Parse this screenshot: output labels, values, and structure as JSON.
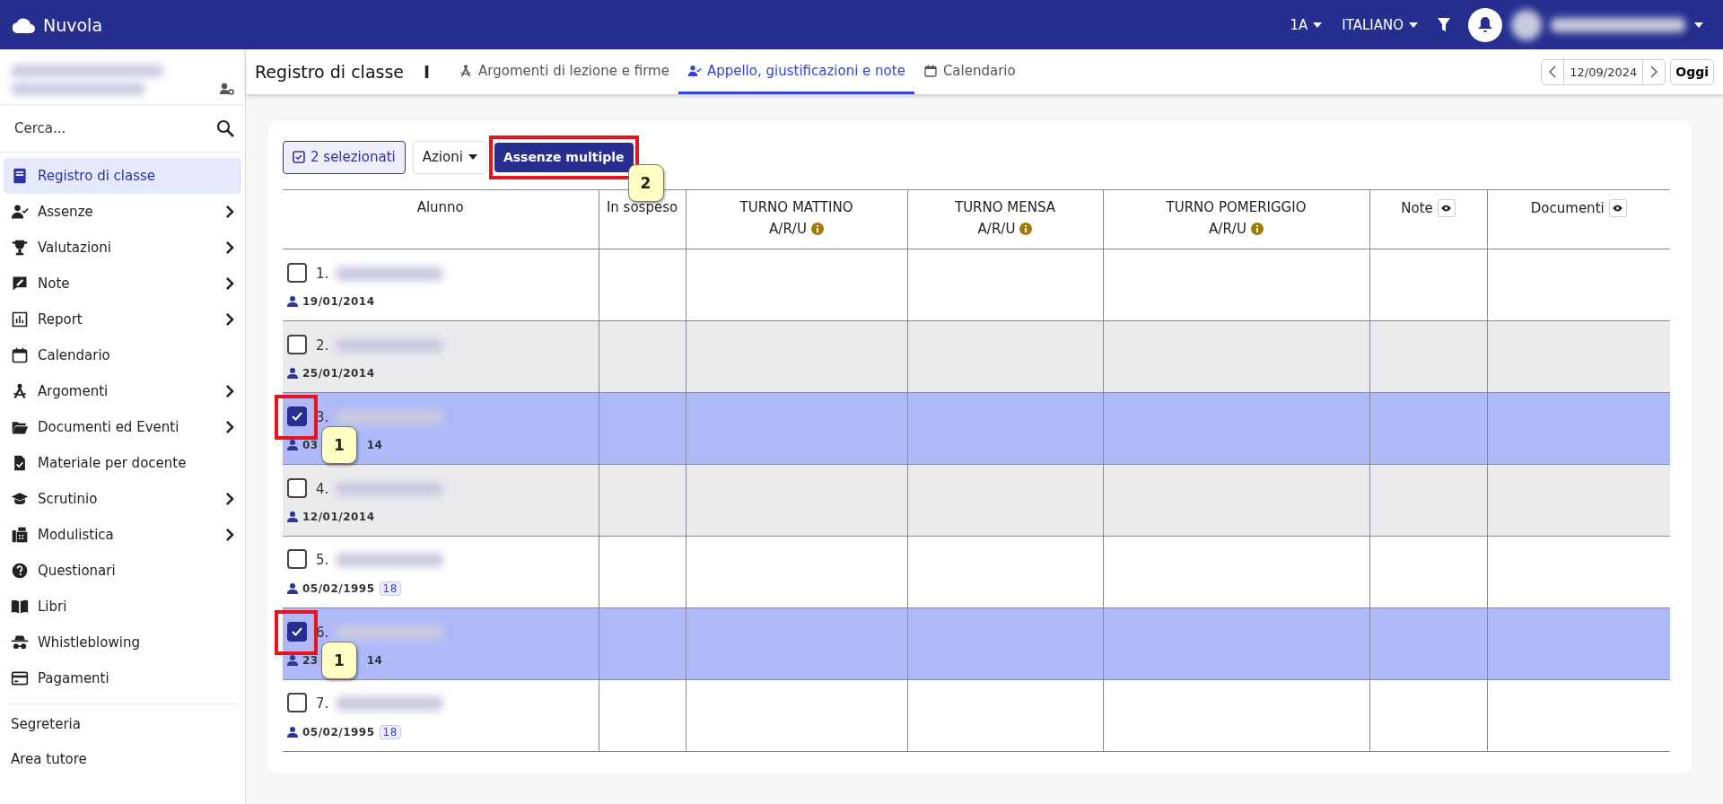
{
  "topbar": {
    "brand": "Nuvola",
    "class_selector": "1A",
    "language": "ITALIANO"
  },
  "sidebar": {
    "search": {
      "placeholder": "Cerca..."
    },
    "items": [
      {
        "label": "Registro di classe",
        "kind": "book",
        "expandable": false,
        "selected": true
      },
      {
        "label": "Assenze",
        "kind": "user-check",
        "expandable": true,
        "selected": false
      },
      {
        "label": "Valutazioni",
        "kind": "trophy",
        "expandable": true,
        "selected": false
      },
      {
        "label": "Note",
        "kind": "note",
        "expandable": true,
        "selected": false
      },
      {
        "label": "Report",
        "kind": "chart",
        "expandable": true,
        "selected": false
      },
      {
        "label": "Calendario",
        "kind": "calendar",
        "expandable": false,
        "selected": false
      },
      {
        "label": "Argomenti",
        "kind": "compass",
        "expandable": true,
        "selected": false
      },
      {
        "label": "Documenti ed Eventi",
        "kind": "folder",
        "expandable": true,
        "selected": false
      },
      {
        "label": "Materiale per docente",
        "kind": "file-check",
        "expandable": false,
        "selected": false
      },
      {
        "label": "Scrutinio",
        "kind": "cap",
        "expandable": true,
        "selected": false
      },
      {
        "label": "Modulistica",
        "kind": "fax",
        "expandable": true,
        "selected": false
      },
      {
        "label": "Questionari",
        "kind": "question",
        "expandable": false,
        "selected": false
      },
      {
        "label": "Libri",
        "kind": "books",
        "expandable": false,
        "selected": false
      },
      {
        "label": "Whistleblowing",
        "kind": "spy",
        "expandable": false,
        "selected": false
      },
      {
        "label": "Pagamenti",
        "kind": "card",
        "expandable": false,
        "selected": false
      }
    ],
    "footer_links": [
      "Segreteria",
      "Area tutore"
    ]
  },
  "header": {
    "title": "Registro di classe",
    "separator": "I",
    "tabs": [
      {
        "label": "Argomenti di lezione e firme",
        "kind": "compass",
        "selected": false
      },
      {
        "label": "Appello, giustificazioni e note",
        "kind": "user-check",
        "selected": true
      },
      {
        "label": "Calendario",
        "kind": "calendar",
        "selected": false
      }
    ],
    "date": "12/09/2024",
    "today_button": "Oggi"
  },
  "toolbar": {
    "selection": "2 selezionati",
    "actions": "Azioni",
    "primary": {
      "label": "Assenze multiple",
      "callout": "2"
    }
  },
  "table": {
    "columns": [
      {
        "label": "Alunno",
        "eye": false
      },
      {
        "label": "In sospeso",
        "eye": false
      },
      {
        "label": "TURNO MATTINO",
        "sub": "A/R/U",
        "eye": false
      },
      {
        "label": "TURNO MENSA",
        "sub": "A/R/U",
        "eye": false
      },
      {
        "label": "TURNO POMERIGGIO",
        "sub": "A/R/U",
        "eye": false
      },
      {
        "label": "Note",
        "eye": true
      },
      {
        "label": "Documenti",
        "eye": true
      }
    ],
    "rows": [
      {
        "number": "1.",
        "date": "19/01/2014",
        "checked": false,
        "shaded": false
      },
      {
        "number": "2.",
        "date": "25/01/2014",
        "checked": false,
        "shaded": true
      },
      {
        "number": "3.",
        "date_parts": [
          "03",
          "14"
        ],
        "checked": true,
        "shaded": false,
        "callout": "1"
      },
      {
        "number": "4.",
        "date": "12/01/2014",
        "checked": false,
        "shaded": true
      },
      {
        "number": "5.",
        "date": "05/02/1995",
        "age": "18",
        "checked": false,
        "shaded": false
      },
      {
        "number": "6.",
        "date_parts": [
          "23",
          "14"
        ],
        "checked": true,
        "shaded": false,
        "callout": "1"
      },
      {
        "number": "7.",
        "date": "05/02/1995",
        "age": "18",
        "checked": false,
        "shaded": false
      }
    ]
  }
}
